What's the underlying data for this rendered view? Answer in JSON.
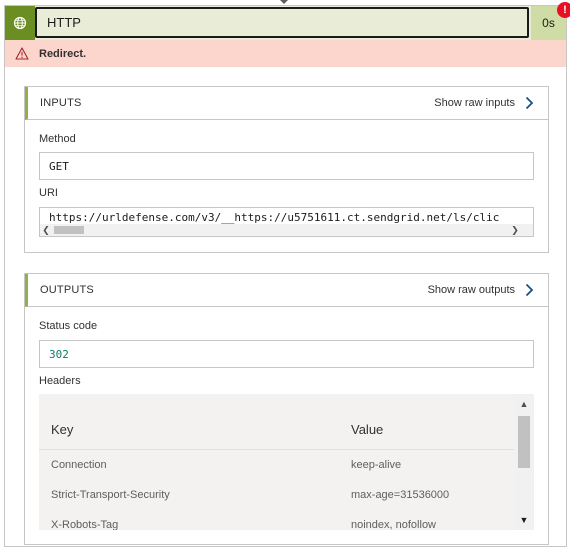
{
  "header": {
    "title": "HTTP",
    "duration": "0s",
    "icon": "globe-icon",
    "error_badge": "!"
  },
  "error": {
    "icon": "warning-icon",
    "message": "Redirect."
  },
  "inputs": {
    "section_title": "INPUTS",
    "raw_link": "Show raw inputs",
    "method_label": "Method",
    "method_value": "GET",
    "uri_label": "URI",
    "uri_value": "https://urldefense.com/v3/__https://u5751611.ct.sendgrid.net/ls/clic"
  },
  "outputs": {
    "section_title": "OUTPUTS",
    "raw_link": "Show raw outputs",
    "status_label": "Status code",
    "status_value": "302",
    "headers_label": "Headers",
    "columns": [
      "Key",
      "Value"
    ],
    "rows": [
      {
        "key": "Connection",
        "value": "keep-alive"
      },
      {
        "key": "Strict-Transport-Security",
        "value": "max-age=31536000"
      },
      {
        "key": "X-Robots-Tag",
        "value": "noindex, nofollow"
      }
    ]
  },
  "colors": {
    "accent_green": "#6b8e23",
    "header_bg": "#e9edd7",
    "error_bg": "#fcd5cd",
    "error_red": "#e81123",
    "status_teal": "#107c6b"
  }
}
